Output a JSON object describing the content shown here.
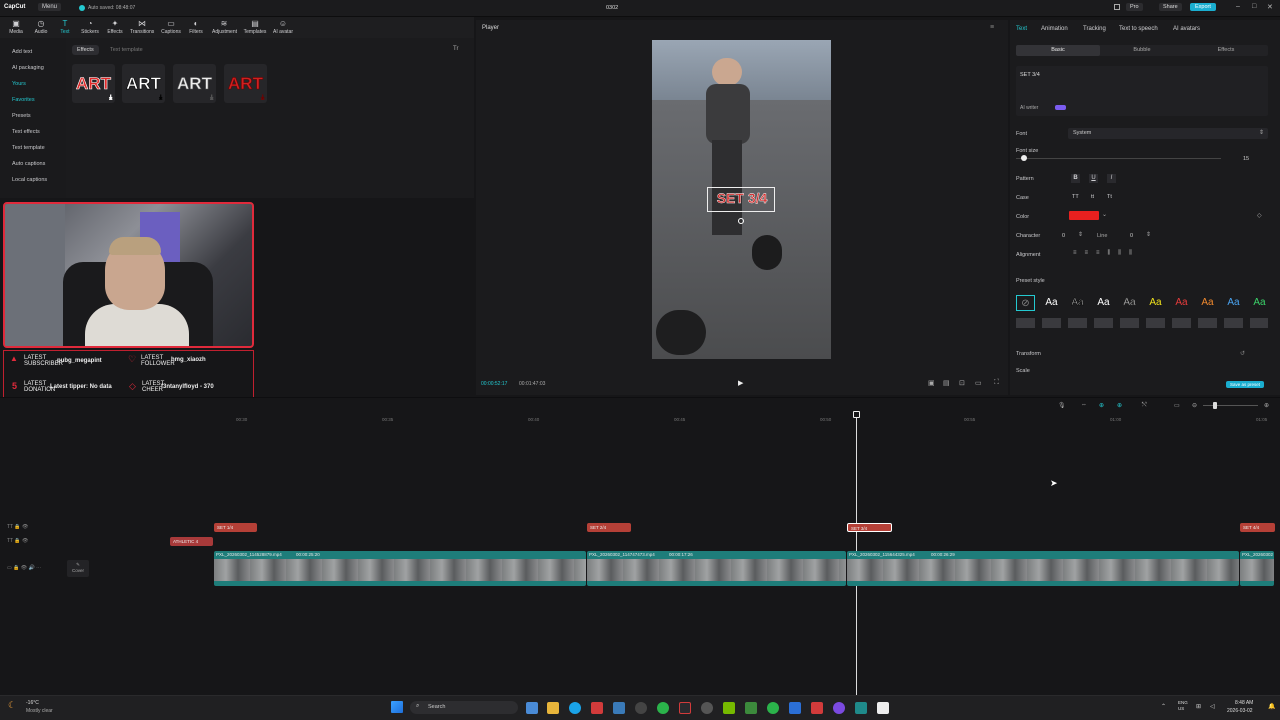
{
  "titlebar": {
    "app": "CapCut",
    "menu": "Menu",
    "autosave": "Auto saved: 08:48:07",
    "project": "0302",
    "pro": "Pro",
    "share": "Share",
    "export": "Export"
  },
  "toolbar": [
    "Media",
    "Audio",
    "Text",
    "Stickers",
    "Effects",
    "Transitions",
    "Captions",
    "Filters",
    "Adjustment",
    "Templates",
    "AI avatar"
  ],
  "leftnav": [
    "Add text",
    "AI packaging",
    "Yours",
    "Favorites",
    "Presets",
    "Text effects",
    "Text template",
    "Auto captions",
    "Local captions"
  ],
  "assets": {
    "tab_effects": "Effects",
    "tab_template": "Text template",
    "art_labels": [
      "ART",
      "ART",
      "ART",
      "ART"
    ]
  },
  "alerts": {
    "latest_subscriber": "LATEST\nSUBSCRIBER",
    "subscriber": "pubg_megapint",
    "latest_follower": "LATEST\nFOLLOWER",
    "follower": "hmg_xiaozh",
    "latest_donation": "LATEST\nDONATION",
    "donation": "Latest tipper: No data",
    "latest_cheer": "LATEST\nCHEER",
    "cheer": "f3ntanylfloyd - 370",
    "count": "5"
  },
  "player": {
    "title": "Player",
    "overlay_text": "SET 3/4",
    "current_time": "00:00:52:17",
    "total_time": "00:01:47:03"
  },
  "right": {
    "tabs": [
      "Text",
      "Animation",
      "Tracking",
      "Text to speech",
      "AI avatars"
    ],
    "subtabs": [
      "Basic",
      "Bubble",
      "Effects"
    ],
    "text_value": "SET 3/4",
    "ai_writer": "AI writer",
    "font_label": "Font",
    "font_value": "System",
    "font_size_label": "Font size",
    "font_size_value": "15",
    "pattern_label": "Pattern",
    "case_label": "Case",
    "color_label": "Color",
    "color_value": "#e8201f",
    "character_label": "Character",
    "character_value": "0",
    "line_label": "Line",
    "line_value": "0",
    "alignment_label": "Alignment",
    "preset_label": "Preset style",
    "preset_glyph": "Aa",
    "transform_label": "Transform",
    "scale_label": "Scale",
    "save_preset": "Save as preset"
  },
  "timeline": {
    "ruler": [
      "00:30",
      "00:35",
      "00:40",
      "00:45",
      "00:50",
      "00:55",
      "01:00",
      "01:05",
      "01:10"
    ],
    "text_clips": [
      "SET 1/4",
      "SET 2/4",
      "SET 3/4",
      "SET 4/4"
    ],
    "attitude_clip": "ATHLETIC 4",
    "video_clips": [
      {
        "name": "PXL_20260302_114528879.mp4",
        "dur": "00:00:25:20"
      },
      {
        "name": "PXL_20260302_114747473.mp4",
        "dur": "00:00:17:26"
      },
      {
        "name": "PXL_20260302_115644325.mp4",
        "dur": "00:00:26:29"
      },
      {
        "name": "PXL_20260302",
        "dur": ""
      }
    ],
    "cover": "Cover"
  },
  "taskbar": {
    "weather_temp": "-16°C",
    "weather_desc": "Mostly clear",
    "search": "Search",
    "lang": "ENG\nUS",
    "time": "8:48 AM",
    "date": "2026-03-02"
  }
}
